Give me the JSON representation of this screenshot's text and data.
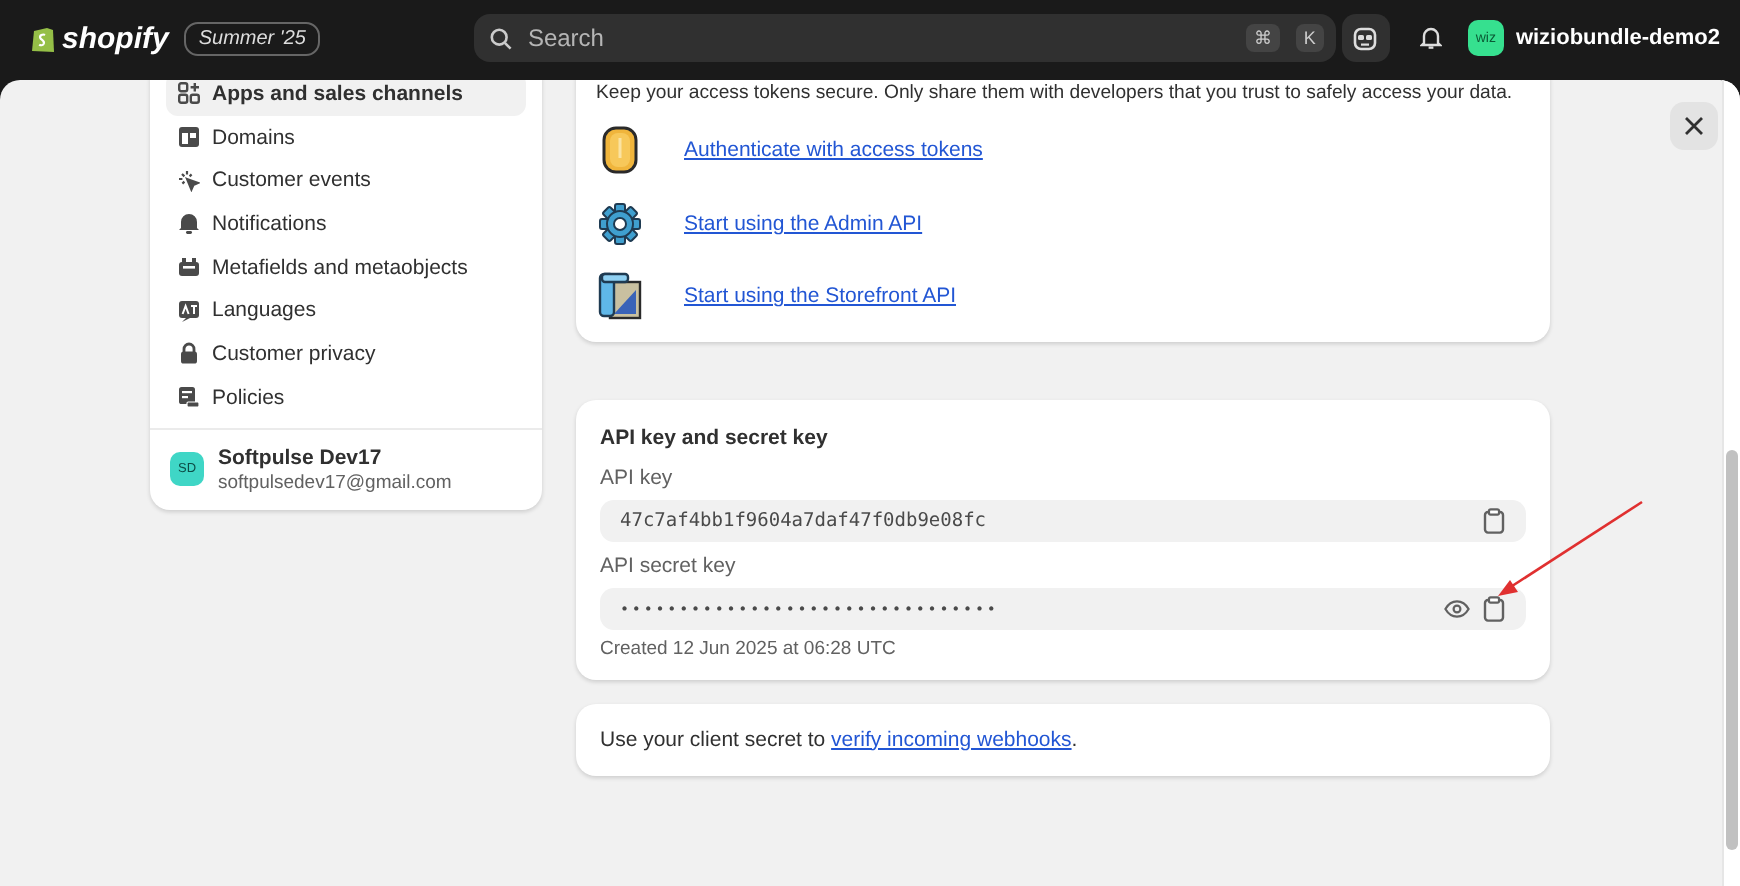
{
  "topbar": {
    "logo": "shopify",
    "edition": "Summer '25",
    "search": {
      "placeholder": "Search",
      "shortcut": [
        "⌘",
        "K"
      ]
    },
    "store": {
      "avatar": "wiz",
      "name": "wiziobundle-demo2"
    }
  },
  "sidebar": {
    "items": [
      {
        "label": "Apps and sales channels",
        "selected": true
      },
      {
        "label": "Domains",
        "selected": false
      },
      {
        "label": "Customer events",
        "selected": false
      },
      {
        "label": "Notifications",
        "selected": false
      },
      {
        "label": "Metafields and metaobjects",
        "selected": false
      },
      {
        "label": "Languages",
        "selected": false
      },
      {
        "label": "Customer privacy",
        "selected": false
      },
      {
        "label": "Policies",
        "selected": false
      }
    ],
    "account": {
      "initials": "SD",
      "name": "Softpulse Dev17",
      "email": "softpulsedev17@gmail.com"
    }
  },
  "access_card": {
    "text": "Keep your access tokens secure. Only share them with developers that you trust to safely access your data.",
    "links": [
      {
        "label": "Authenticate with access tokens",
        "kind": "token"
      },
      {
        "label": "Start using the Admin API",
        "kind": "gear"
      },
      {
        "label": "Start using the Storefront API",
        "kind": "storefront"
      }
    ]
  },
  "keys_card": {
    "title": "API key and secret key",
    "fields": [
      {
        "label": "API key",
        "value": "47c7af4bb1f9604a7daf47f0db9e08fc",
        "masked": false
      },
      {
        "label": "API secret key",
        "value": "••••••••••••••••••••••••••••••••",
        "masked": true
      }
    ],
    "created": "Created 12 Jun 2025 at 06:28 UTC"
  },
  "webhooks_card": {
    "before": "Use your client secret to ",
    "link": "verify incoming webhooks",
    "after": "."
  }
}
